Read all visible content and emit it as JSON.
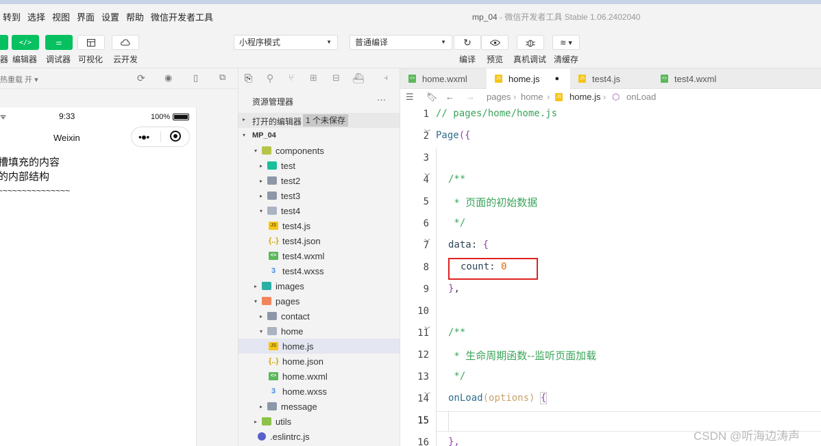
{
  "window": {
    "app_name": "mp_04",
    "subtitle": " - 微信开发者工具 Stable 1.06.2402040"
  },
  "menu": [
    "转到",
    "选择",
    "视图",
    "界面",
    "设置",
    "帮助",
    "微信开发者工具"
  ],
  "toolbar": {
    "left_buttons": [
      {
        "label": "器",
        "icon": "simulator-icon"
      },
      {
        "label": "编辑器",
        "icon": "code-icon"
      },
      {
        "label": "调试器",
        "icon": "debug-toggle-icon"
      },
      {
        "label": "可视化",
        "icon": "layout-icon"
      },
      {
        "label": "云开发",
        "icon": "cloud-icon"
      }
    ],
    "mode_select": "小程序模式",
    "compile_select": "普通编译",
    "right_buttons": [
      {
        "label": "编译",
        "icon": "refresh-icon"
      },
      {
        "label": "预览",
        "icon": "eye-icon"
      },
      {
        "label": "真机调试",
        "icon": "bug-icon"
      },
      {
        "label": "清缓存",
        "icon": "layers-icon"
      }
    ]
  },
  "simulator": {
    "hot_reload": "热重载 开 ▾",
    "status_time": "9:33",
    "battery": "100%",
    "nav_title": "Weixin",
    "content_lines": [
      "槽填充的内容",
      "的内部结构",
      "~~~~~~~~~~~~~~~"
    ]
  },
  "explorer": {
    "title": "资源管理器",
    "more": "···",
    "open_editors_label": "打开的编辑器",
    "unsaved_badge": "1 个未保存",
    "project": "MP_04",
    "tree": [
      {
        "label": "components",
        "icon": "folder-components-icon",
        "arrow": "▾",
        "depth": 1
      },
      {
        "label": "test",
        "icon": "folder-test-icon",
        "arrow": "▸",
        "depth": 2
      },
      {
        "label": "test2",
        "icon": "folder-icon",
        "arrow": "▸",
        "depth": 2
      },
      {
        "label": "test3",
        "icon": "folder-icon",
        "arrow": "▸",
        "depth": 2
      },
      {
        "label": "test4",
        "icon": "folder-open-icon",
        "arrow": "▾",
        "depth": 2
      },
      {
        "label": "test4.js",
        "icon": "js-file-icon",
        "arrow": "",
        "depth": 3
      },
      {
        "label": "test4.json",
        "icon": "json-file-icon",
        "arrow": "",
        "depth": 3
      },
      {
        "label": "test4.wxml",
        "icon": "wxml-file-icon",
        "arrow": "",
        "depth": 3
      },
      {
        "label": "test4.wxss",
        "icon": "wxss-file-icon",
        "arrow": "",
        "depth": 3
      },
      {
        "label": "images",
        "icon": "folder-images-icon",
        "arrow": "▸",
        "depth": 1
      },
      {
        "label": "pages",
        "icon": "folder-pages-icon",
        "arrow": "▾",
        "depth": 1
      },
      {
        "label": "contact",
        "icon": "folder-icon",
        "arrow": "▸",
        "depth": 2
      },
      {
        "label": "home",
        "icon": "folder-open-icon",
        "arrow": "▾",
        "depth": 2
      },
      {
        "label": "home.js",
        "icon": "js-file-icon",
        "arrow": "",
        "depth": 3,
        "selected": true
      },
      {
        "label": "home.json",
        "icon": "json-file-icon",
        "arrow": "",
        "depth": 3
      },
      {
        "label": "home.wxml",
        "icon": "wxml-file-icon",
        "arrow": "",
        "depth": 3
      },
      {
        "label": "home.wxss",
        "icon": "wxss-file-icon",
        "arrow": "",
        "depth": 3
      },
      {
        "label": "message",
        "icon": "folder-icon",
        "arrow": "▸",
        "depth": 2
      },
      {
        "label": "utils",
        "icon": "folder-utils-icon",
        "arrow": "▸",
        "depth": 1
      },
      {
        "label": ".eslintrc.js",
        "icon": "eslint-file-icon",
        "arrow": "",
        "depth": 1
      }
    ]
  },
  "editor": {
    "tabs": [
      {
        "label": "home.wxml",
        "icon": "wxml-file-icon",
        "active": false
      },
      {
        "label": "home.js",
        "icon": "js-file-icon",
        "active": true,
        "modified": "●"
      },
      {
        "label": "test4.js",
        "icon": "js-file-icon",
        "active": false
      },
      {
        "label": "test4.wxml",
        "icon": "wxml-file-icon",
        "active": false
      }
    ],
    "breadcrumb": [
      "pages",
      "home",
      "home.js",
      "onLoad"
    ],
    "line_numbers": [
      "1",
      "2",
      "3",
      "4",
      "5",
      "6",
      "7",
      "8",
      "9",
      "10",
      "11",
      "12",
      "13",
      "14",
      "15",
      "16"
    ],
    "code": {
      "l1": "// pages/home/home.js",
      "l2a": "Page",
      "l2b": "({",
      "l4": "/**",
      "l5a": " * ",
      "l5b": "页面的初始数据",
      "l6": " */",
      "l7a": "data",
      "l7b": ": ",
      "l7c": "{",
      "l8a": "count",
      "l8b": ": ",
      "l8c": "0",
      "l9a": "}",
      "l9b": ",",
      "l11": "/**",
      "l12a": " * ",
      "l12b": "生命周期函数--监听页面加载",
      "l13": " */",
      "l14a": "onLoad",
      "l14b": "(",
      "l14c": "options",
      "l14d": ") ",
      "l14e": "{",
      "l16": "},"
    }
  },
  "watermark": "CSDN @听海边涛声"
}
